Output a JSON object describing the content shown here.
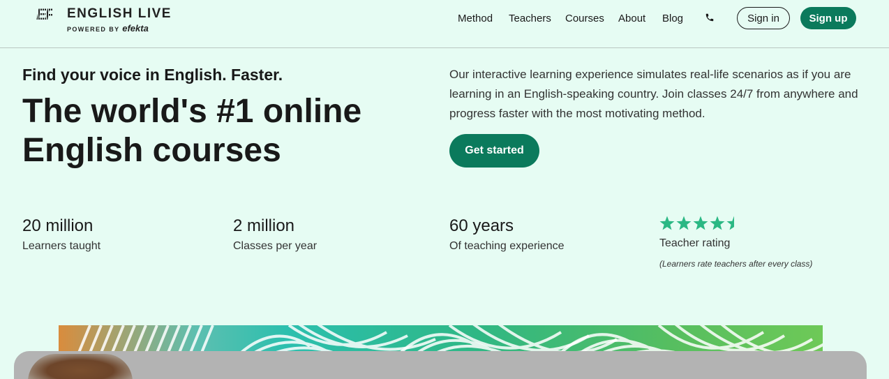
{
  "brand": {
    "mark": "EF",
    "title": "ENGLISH LIVE",
    "powered_by": "POWERED BY",
    "powered_brand": "efekta"
  },
  "nav": {
    "items": [
      {
        "label": "Method"
      },
      {
        "label": "Teachers"
      },
      {
        "label": "Courses"
      },
      {
        "label": "About"
      },
      {
        "label": "Blog"
      }
    ],
    "phone_icon": "phone-icon",
    "sign_in": "Sign in",
    "sign_up": "Sign up"
  },
  "hero": {
    "tagline": "Find your voice in English. Faster.",
    "headline": "The world's #1 online English courses",
    "description": "Our interactive learning experience simulates real-life scenarios as if you are learning in an English-speaking country. Join classes 24/7 from anywhere and progress faster with the most motivating method.",
    "cta": "Get started"
  },
  "stats": [
    {
      "value": "20 million",
      "label": "Learners taught"
    },
    {
      "value": "2 million",
      "label": "Classes per year"
    },
    {
      "value": "60 years",
      "label": "Of teaching experience"
    }
  ],
  "rating": {
    "stars": 4.5,
    "max_stars": 5,
    "label": "Teacher rating",
    "note": "(Learners rate teachers after every class)"
  },
  "colors": {
    "background": "#e6fcf3",
    "brand_green": "#0b7a5c",
    "star_green": "#2bb884"
  }
}
